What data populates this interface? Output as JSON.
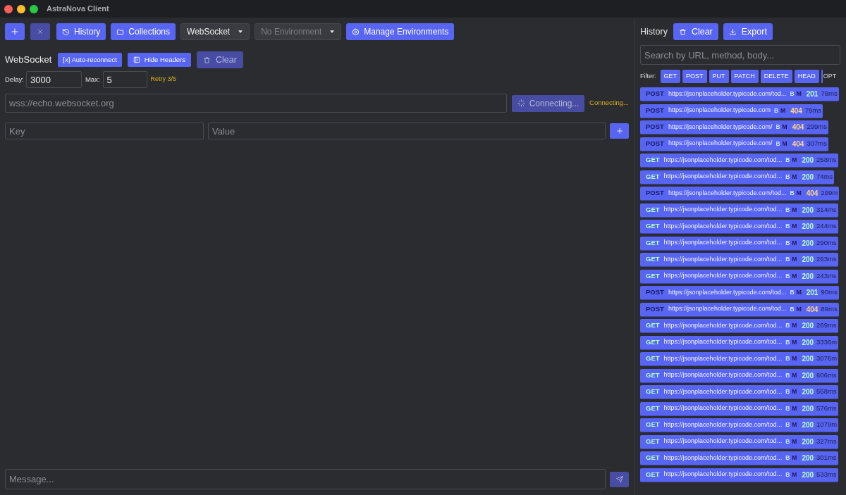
{
  "window": {
    "title": "AstraNova Client"
  },
  "toolbar": [
    {
      "kind": "new",
      "disabled": false
    },
    {
      "kind": "close",
      "disabled": true
    },
    {
      "kind": "history",
      "label": "History",
      "disabled": false
    },
    {
      "kind": "collections",
      "label": "Collections",
      "disabled": false
    },
    {
      "kind": "select",
      "value": "WebSocket",
      "disabled": false
    },
    {
      "kind": "select",
      "value": "No Environment",
      "disabled": true
    },
    {
      "kind": "environments",
      "label": "Manage Environments",
      "disabled": false
    }
  ],
  "websocket": {
    "title": "WebSocket",
    "actions": [
      {
        "kind": "toggle",
        "label": "[x] Auto-reconnect",
        "disabled": false
      },
      {
        "kind": "headers",
        "label": "Hide Headers",
        "disabled": false
      },
      {
        "kind": "clear",
        "label": "Clear",
        "disabled": true
      }
    ],
    "delay": {
      "label": "Delay:",
      "value": "3000"
    },
    "max": {
      "label": "Max:",
      "value": "5"
    },
    "retry_status": "Retry 3/5",
    "url": {
      "placeholder": "wss://echo.websocket.org"
    },
    "connect_button": {
      "label": "Connecting...",
      "disabled": true
    },
    "connection_status": "Connecting...",
    "header_row": {
      "key": {
        "placeholder": "Key"
      },
      "value": {
        "placeholder": "Value"
      }
    },
    "message": {
      "placeholder": "Message..."
    },
    "send_button": {
      "disabled": true
    }
  },
  "history": {
    "title": "History",
    "buttons": [
      {
        "kind": "clear",
        "label": "Clear"
      },
      {
        "kind": "export",
        "label": "Export"
      }
    ],
    "search": {
      "placeholder": "Search by URL, method, body..."
    },
    "filter_label": "Filter:",
    "filters": [
      "GET",
      "POST",
      "PUT",
      "PATCH",
      "DELETE",
      "HEAD",
      "OPT"
    ],
    "items": [
      {
        "method": {
          "label": "POST",
          "color": "#161b5e"
        },
        "url": "https://jsonplaceholder.typicode.com/tod...",
        "flags": [
          "B",
          "M"
        ],
        "status": {
          "label": "201",
          "color": "#b5ffc4"
        },
        "duration": "78ms"
      },
      {
        "method": {
          "label": "POST",
          "color": "#161b5e"
        },
        "url": "https://jsonplaceholder.typicode.com",
        "flags": [
          "B",
          "M"
        ],
        "status": {
          "label": "404",
          "color": "#ffd58a"
        },
        "duration": "79ms"
      },
      {
        "method": {
          "label": "POST",
          "color": "#161b5e"
        },
        "url": "https://jsonplaceholder.typicode.com/",
        "flags": [
          "B",
          "M"
        ],
        "status": {
          "label": "404",
          "color": "#ffd58a"
        },
        "duration": "299ms"
      },
      {
        "method": {
          "label": "POST",
          "color": "#161b5e"
        },
        "url": "https://jsonplaceholder.typicode.com/",
        "flags": [
          "B",
          "M"
        ],
        "status": {
          "label": "404",
          "color": "#ffd58a"
        },
        "duration": "307ms"
      },
      {
        "method": {
          "label": "GET",
          "color": "#b5ffc4"
        },
        "url": "https://jsonplaceholder.typicode.com/tod...",
        "flags": [
          "B",
          "M"
        ],
        "status": {
          "label": "200",
          "color": "#b5ffc4"
        },
        "duration": "258ms"
      },
      {
        "method": {
          "label": "GET",
          "color": "#b5ffc4"
        },
        "url": "https://jsonplaceholder.typicode.com/tod...",
        "flags": [
          "B",
          "M"
        ],
        "status": {
          "label": "200",
          "color": "#b5ffc4"
        },
        "duration": "74ms"
      },
      {
        "method": {
          "label": "POST",
          "color": "#161b5e"
        },
        "url": "https://jsonplaceholder.typicode.com/tod...",
        "flags": [
          "B",
          "M"
        ],
        "status": {
          "label": "404",
          "color": "#ffd58a"
        },
        "duration": "299m"
      },
      {
        "method": {
          "label": "GET",
          "color": "#b5ffc4"
        },
        "url": "https://jsonplaceholder.typicode.com/tod...",
        "flags": [
          "B",
          "M"
        ],
        "status": {
          "label": "200",
          "color": "#b5ffc4"
        },
        "duration": "314ms"
      },
      {
        "method": {
          "label": "GET",
          "color": "#b5ffc4"
        },
        "url": "https://jsonplaceholder.typicode.com/tod...",
        "flags": [
          "B",
          "M"
        ],
        "status": {
          "label": "200",
          "color": "#b5ffc4"
        },
        "duration": "244ms"
      },
      {
        "method": {
          "label": "GET",
          "color": "#b5ffc4"
        },
        "url": "https://jsonplaceholder.typicode.com/tod...",
        "flags": [
          "B",
          "M"
        ],
        "status": {
          "label": "200",
          "color": "#b5ffc4"
        },
        "duration": "290ms"
      },
      {
        "method": {
          "label": "GET",
          "color": "#b5ffc4"
        },
        "url": "https://jsonplaceholder.typicode.com/tod...",
        "flags": [
          "B",
          "M"
        ],
        "status": {
          "label": "200",
          "color": "#b5ffc4"
        },
        "duration": "263ms"
      },
      {
        "method": {
          "label": "GET",
          "color": "#b5ffc4"
        },
        "url": "https://jsonplaceholder.typicode.com/tod...",
        "flags": [
          "B",
          "M"
        ],
        "status": {
          "label": "200",
          "color": "#b5ffc4"
        },
        "duration": "243ms"
      },
      {
        "method": {
          "label": "POST",
          "color": "#161b5e"
        },
        "url": "https://jsonplaceholder.typicode.com/tod...",
        "flags": [
          "B",
          "M"
        ],
        "status": {
          "label": "201",
          "color": "#b5ffc4"
        },
        "duration": "90ms"
      },
      {
        "method": {
          "label": "POST",
          "color": "#161b5e"
        },
        "url": "https://jsonplaceholder.typicode.com/tod...",
        "flags": [
          "B",
          "M"
        ],
        "status": {
          "label": "404",
          "color": "#ffd58a"
        },
        "duration": "89ms"
      },
      {
        "method": {
          "label": "GET",
          "color": "#b5ffc4"
        },
        "url": "https://jsonplaceholder.typicode.com/tod...",
        "flags": [
          "B",
          "M"
        ],
        "status": {
          "label": "200",
          "color": "#b5ffc4"
        },
        "duration": "269ms"
      },
      {
        "method": {
          "label": "GET",
          "color": "#b5ffc4"
        },
        "url": "https://jsonplaceholder.typicode.com/tod...",
        "flags": [
          "B",
          "M"
        ],
        "status": {
          "label": "200",
          "color": "#b5ffc4"
        },
        "duration": "3336m"
      },
      {
        "method": {
          "label": "GET",
          "color": "#b5ffc4"
        },
        "url": "https://jsonplaceholder.typicode.com/tod...",
        "flags": [
          "B",
          "M"
        ],
        "status": {
          "label": "200",
          "color": "#b5ffc4"
        },
        "duration": "3076m"
      },
      {
        "method": {
          "label": "GET",
          "color": "#b5ffc4"
        },
        "url": "https://jsonplaceholder.typicode.com/tod...",
        "flags": [
          "B",
          "M"
        ],
        "status": {
          "label": "200",
          "color": "#b5ffc4"
        },
        "duration": "606ms"
      },
      {
        "method": {
          "label": "GET",
          "color": "#b5ffc4"
        },
        "url": "https://jsonplaceholder.typicode.com/tod...",
        "flags": [
          "B",
          "M"
        ],
        "status": {
          "label": "200",
          "color": "#b5ffc4"
        },
        "duration": "558ms"
      },
      {
        "method": {
          "label": "GET",
          "color": "#b5ffc4"
        },
        "url": "https://jsonplaceholder.typicode.com/tod...",
        "flags": [
          "B",
          "M"
        ],
        "status": {
          "label": "200",
          "color": "#b5ffc4"
        },
        "duration": "576ms"
      },
      {
        "method": {
          "label": "GET",
          "color": "#b5ffc4"
        },
        "url": "https://jsonplaceholder.typicode.com/tod...",
        "flags": [
          "B",
          "M"
        ],
        "status": {
          "label": "200",
          "color": "#b5ffc4"
        },
        "duration": "1079m"
      },
      {
        "method": {
          "label": "GET",
          "color": "#b5ffc4"
        },
        "url": "https://jsonplaceholder.typicode.com/tod...",
        "flags": [
          "B",
          "M"
        ],
        "status": {
          "label": "200",
          "color": "#b5ffc4"
        },
        "duration": "327ms"
      },
      {
        "method": {
          "label": "GET",
          "color": "#b5ffc4"
        },
        "url": "https://jsonplaceholder.typicode.com/tod...",
        "flags": [
          "B",
          "M"
        ],
        "status": {
          "label": "200",
          "color": "#b5ffc4"
        },
        "duration": "301ms"
      },
      {
        "method": {
          "label": "GET",
          "color": "#b5ffc4"
        },
        "url": "https://jsonplaceholder.typicode.com/tod...",
        "flags": [
          "B",
          "M"
        ],
        "status": {
          "label": "200",
          "color": "#b5ffc4"
        },
        "duration": "533ms"
      }
    ]
  }
}
